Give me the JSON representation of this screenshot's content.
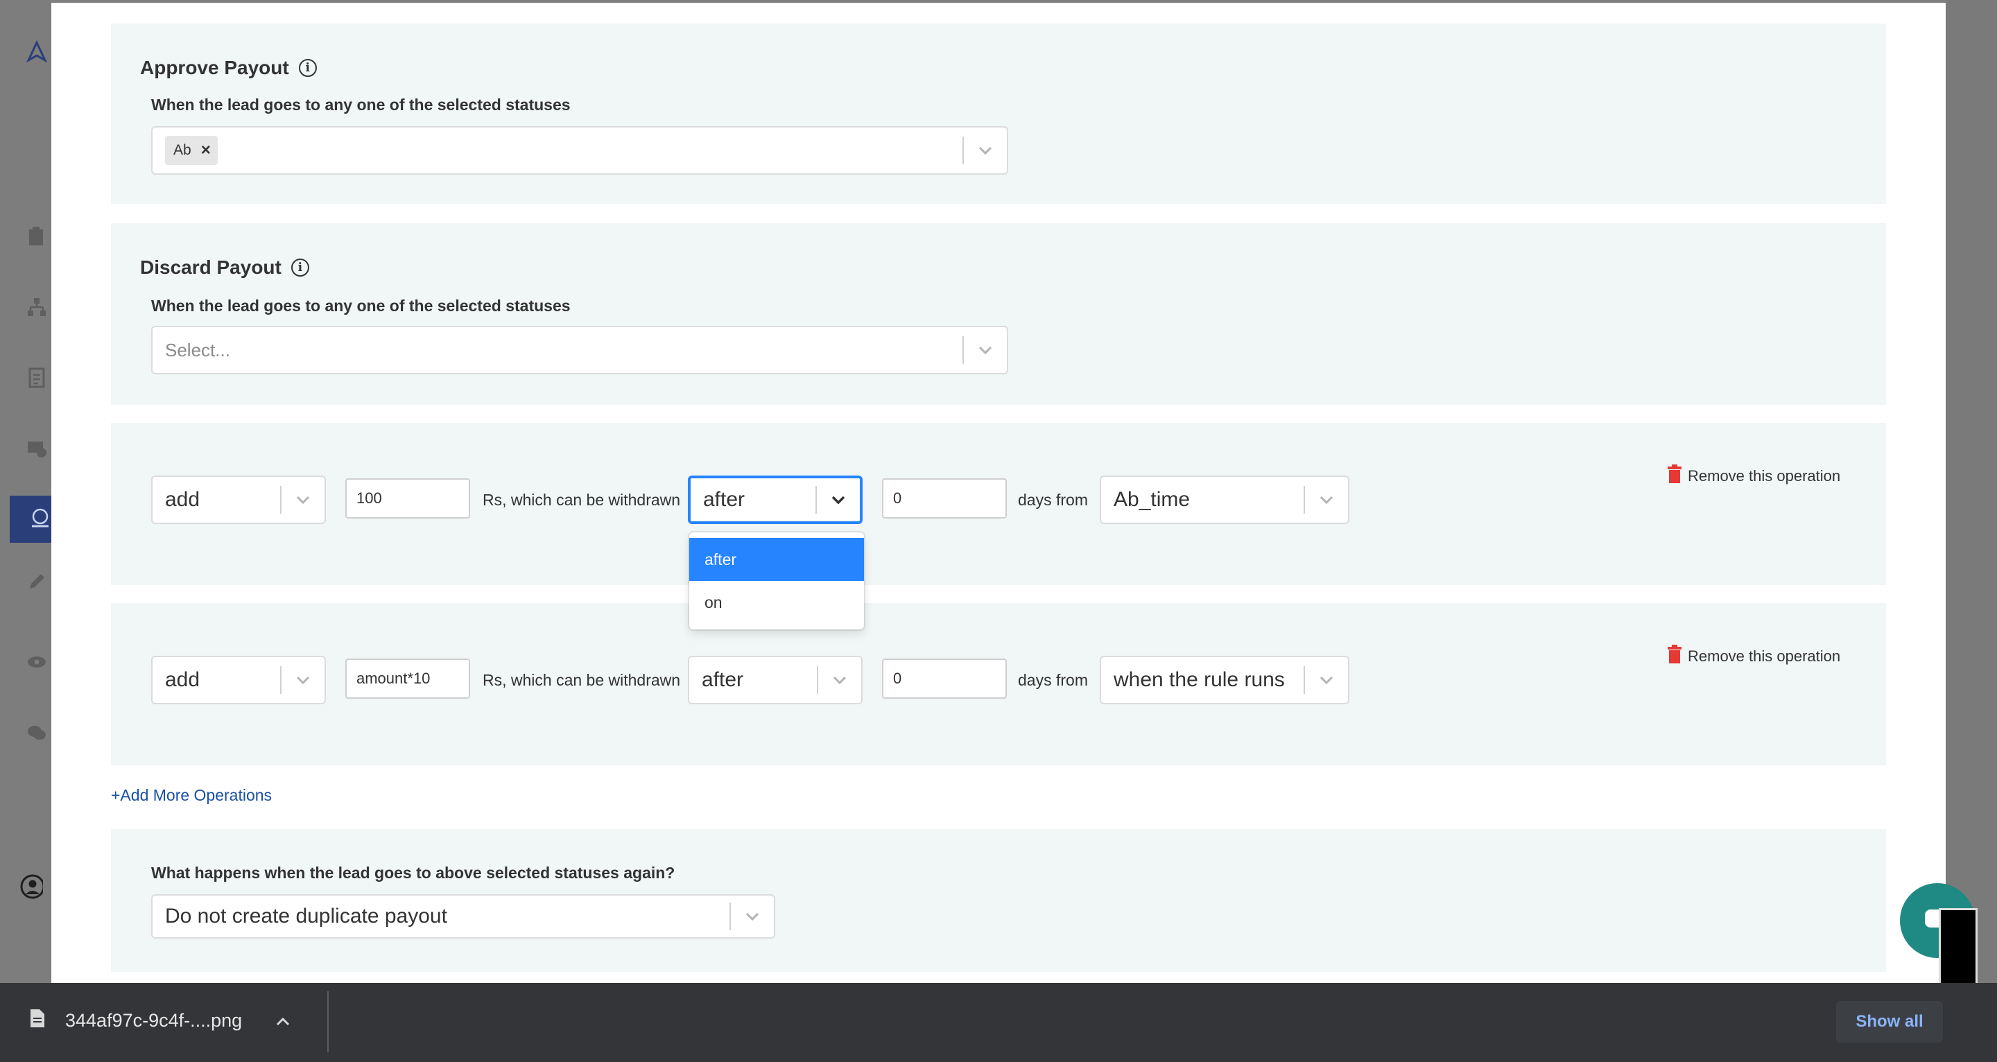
{
  "approve_payout": {
    "title": "Approve Payout",
    "label": "When the lead goes to any one of the selected statuses",
    "selected_tag": "Ab",
    "tag_remove": "×"
  },
  "discard_payout": {
    "title": "Discard Payout",
    "label": "When the lead goes to any one of the selected statuses",
    "placeholder": "Select..."
  },
  "operations": [
    {
      "action": "add",
      "amount": "100",
      "middle_text": "Rs, which can be withdrawn",
      "timing": "after",
      "days": "0",
      "days_text": "days from",
      "from": "Ab_time",
      "remove_label": "Remove this operation"
    },
    {
      "action": "add",
      "amount": "amount*10",
      "middle_text": "Rs, which can be withdrawn",
      "timing": "after",
      "days": "0",
      "days_text": "days from",
      "from": "when the rule runs",
      "remove_label": "Remove this operation"
    }
  ],
  "timing_dropdown": {
    "options": [
      "after",
      "on"
    ],
    "selected": "after"
  },
  "add_more_label": "+Add More Operations",
  "duplicate": {
    "label": "What happens when the lead goes to above selected statuses again?",
    "value": "Do not create duplicate payout"
  },
  "downloads_bar": {
    "file_name": "344af97c-9c4f-....png",
    "show_all": "Show all"
  },
  "colors": {
    "accent": "#2684ff",
    "panel_bg": "#f1f6f6",
    "remove_icon": "#e53935",
    "link": "#1a4fa3"
  }
}
